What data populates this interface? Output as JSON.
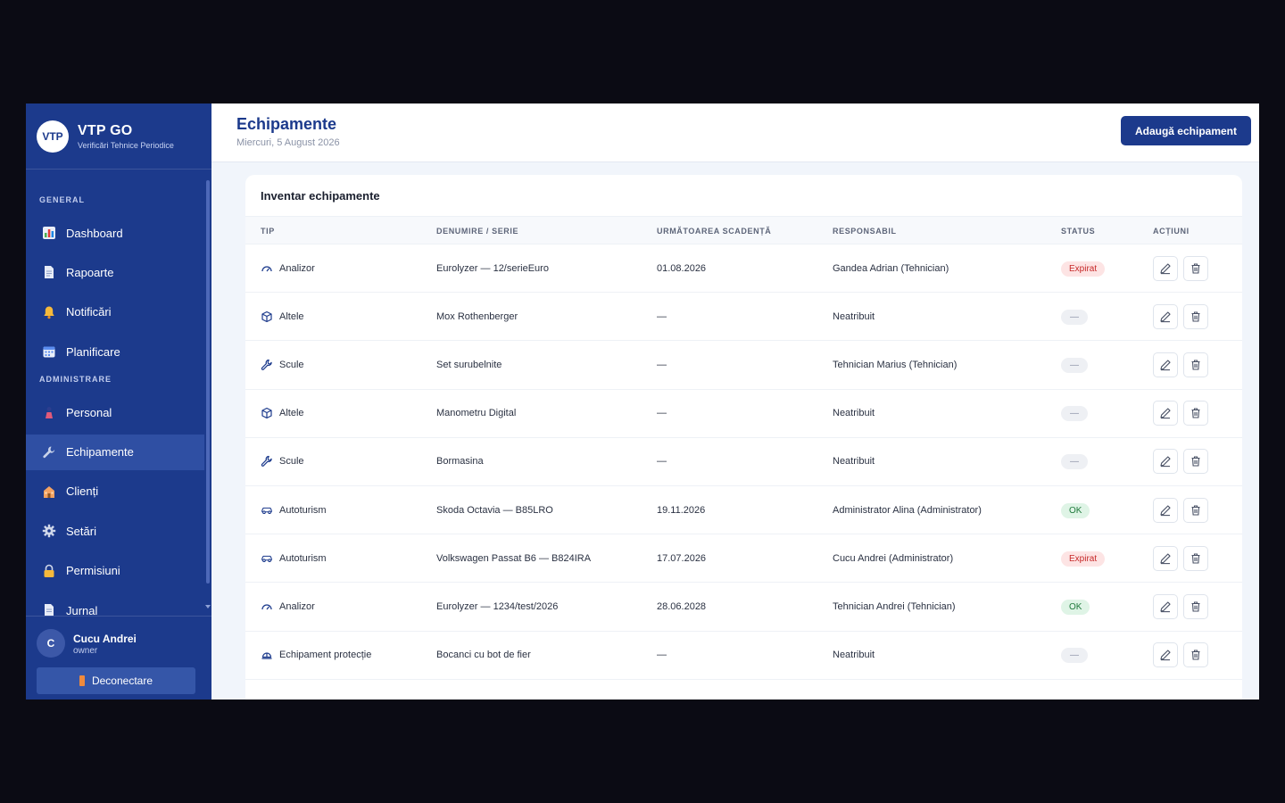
{
  "brand": {
    "logo": "VTP",
    "title": "VTP GO",
    "subtitle": "Verificări Tehnice Periodice"
  },
  "sidebar": {
    "sections": [
      "GENERAL",
      "ADMINISTRARE"
    ],
    "items": [
      {
        "label": "Dashboard",
        "icon": "bar-chart-icon"
      },
      {
        "label": "Rapoarte",
        "icon": "document-icon"
      },
      {
        "label": "Notificări",
        "icon": "bell-icon"
      },
      {
        "label": "Planificare",
        "icon": "calendar-icon"
      },
      {
        "label": "Personal",
        "icon": "person-icon"
      },
      {
        "label": "Echipamente",
        "icon": "wrench-icon",
        "active": true
      },
      {
        "label": "Clienți",
        "icon": "building-icon"
      },
      {
        "label": "Setări",
        "icon": "gear-icon"
      },
      {
        "label": "Permisiuni",
        "icon": "lock-icon"
      },
      {
        "label": "Jurnal",
        "icon": "journal-icon"
      }
    ]
  },
  "user": {
    "initial": "C",
    "name": "Cucu Andrei",
    "role": "owner",
    "logout_label": "Deconectare"
  },
  "header": {
    "title": "Echipamente",
    "date": "Miercuri, 5 August 2026",
    "add_label": "Adaugă echipament"
  },
  "card": {
    "title": "Inventar echipamente",
    "columns": [
      "TIP",
      "DENUMIRE / SERIE",
      "URMĂTOAREA SCADENȚĂ",
      "RESPONSABIL",
      "STATUS",
      "ACȚIUNI"
    ]
  },
  "rows": [
    {
      "tip": "Analizor",
      "icon": "gauge-icon",
      "name": "Eurolyzer — 12/serieEuro",
      "due": "01.08.2026",
      "resp": "Gandea Adrian (Tehnician)",
      "status": "Expirat",
      "status_kind": "expired"
    },
    {
      "tip": "Altele",
      "icon": "box-icon",
      "name": "Mox Rothenberger",
      "due": "—",
      "resp": "Neatribuit",
      "status": "—",
      "status_kind": "none"
    },
    {
      "tip": "Scule",
      "icon": "wrench-icon",
      "name": "Set surubelnite",
      "due": "—",
      "resp": "Tehnician Marius (Tehnician)",
      "status": "—",
      "status_kind": "none"
    },
    {
      "tip": "Altele",
      "icon": "box-icon",
      "name": "Manometru Digital",
      "due": "—",
      "resp": "Neatribuit",
      "status": "—",
      "status_kind": "none"
    },
    {
      "tip": "Scule",
      "icon": "wrench-icon",
      "name": "Bormasina",
      "due": "—",
      "resp": "Neatribuit",
      "status": "—",
      "status_kind": "none"
    },
    {
      "tip": "Autoturism",
      "icon": "car-icon",
      "name": "Skoda Octavia — B85LRO",
      "due": "19.11.2026",
      "resp": "Administrator Alina (Administrator)",
      "status": "OK",
      "status_kind": "ok"
    },
    {
      "tip": "Autoturism",
      "icon": "car-icon",
      "name": "Volkswagen Passat B6 — B824IRA",
      "due": "17.07.2026",
      "resp": "Cucu Andrei (Administrator)",
      "status": "Expirat",
      "status_kind": "expired"
    },
    {
      "tip": "Analizor",
      "icon": "gauge-icon",
      "name": "Eurolyzer — 1234/test/2026",
      "due": "28.06.2028",
      "resp": "Tehnician Andrei (Tehnician)",
      "status": "OK",
      "status_kind": "ok"
    },
    {
      "tip": "Echipament protecție",
      "icon": "helmet-icon",
      "name": "Bocanci cu bot de fier",
      "due": "—",
      "resp": "Neatribuit",
      "status": "—",
      "status_kind": "none"
    }
  ],
  "colors": {
    "sidebar": "#1c3a8c",
    "accent": "#1c3a8c",
    "expired": "#c62828",
    "ok": "#1f7a3c"
  }
}
